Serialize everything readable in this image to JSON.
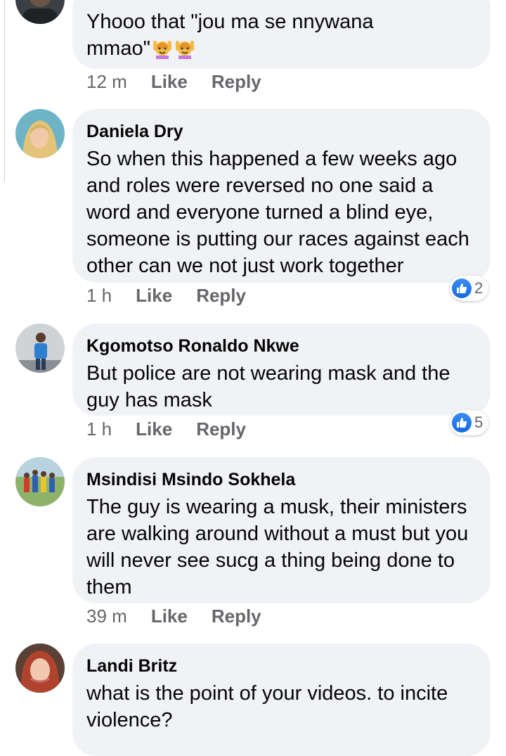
{
  "comments": [
    {
      "author": "",
      "text_line1": "Yhooo that \"jou ma se nnywana",
      "text_line2": "mmao\"",
      "emoji": "woman-raising-hands-emoji",
      "time": "12 m",
      "like_label": "Like",
      "reply_label": "Reply"
    },
    {
      "author": "Daniela Dry",
      "text": "So when this happened a few weeks ago and roles were reversed no one said a word and everyone turned a blind eye, someone is putting our races against each other can we not just work together",
      "time": "1 h",
      "like_label": "Like",
      "reply_label": "Reply",
      "reaction_count": "2",
      "reaction_icon": "like-icon"
    },
    {
      "author": "Kgomotso Ronaldo Nkwe",
      "text": "But police are not wearing mask and the guy has mask",
      "time": "1 h",
      "like_label": "Like",
      "reply_label": "Reply",
      "reaction_count": "5",
      "reaction_icon": "like-icon"
    },
    {
      "author": "Msindisi Msindo Sokhela",
      "text": "The guy is wearing a musk, their ministers are walking around without a must but you will never see sucg a thing being done to them",
      "time": "39 m",
      "like_label": "Like",
      "reply_label": "Reply"
    },
    {
      "author": "Landi Britz",
      "text": "what is the point of your videos. to incite violence?"
    }
  ],
  "colors": {
    "bubble": "#f0f2f5",
    "meta_text": "#65676b",
    "like_blue": "#1877f2"
  }
}
